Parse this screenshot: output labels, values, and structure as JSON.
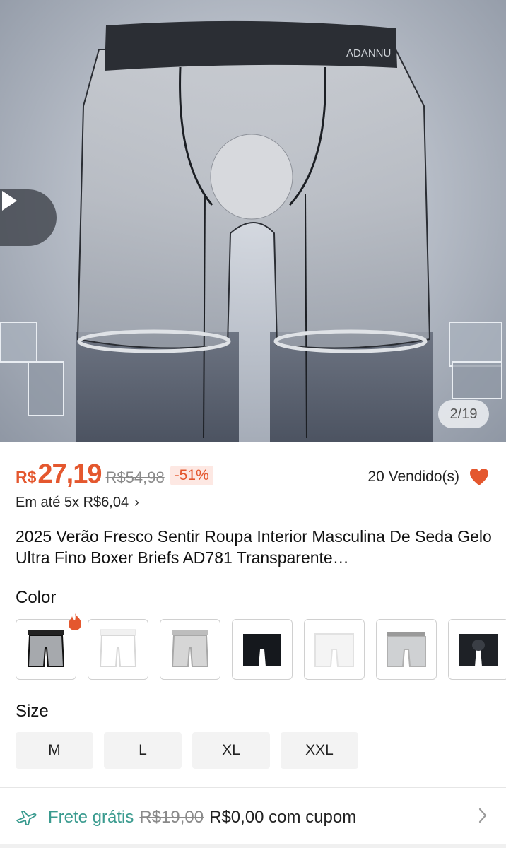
{
  "gallery": {
    "counter": "2/19",
    "brand_text": "ADANNU"
  },
  "price": {
    "currency": "R$",
    "current": "27,19",
    "original": "R$54,98",
    "discount": "-51%"
  },
  "sold": "20 Vendido(s)",
  "installment": "Em até 5x R$6,04",
  "title": "2025 Verão Fresco Sentir Roupa Interior Masculina De Seda Gelo Ultra Fino Boxer Briefs AD781 Transparente…",
  "color_section": {
    "label": "Color",
    "swatches": [
      "sheer-black",
      "white",
      "light-gray",
      "black",
      "sheer-white",
      "gray-stripe",
      "black-solid"
    ]
  },
  "size_section": {
    "label": "Size",
    "options": [
      "M",
      "L",
      "XL",
      "XXL"
    ]
  },
  "shipping": {
    "free_label": "Frete grátis",
    "old_price": "R$19,00",
    "new_price": "R$0,00 com cupom"
  },
  "colors": {
    "accent": "#e4572e",
    "shipping_green": "#3a9b8f"
  }
}
